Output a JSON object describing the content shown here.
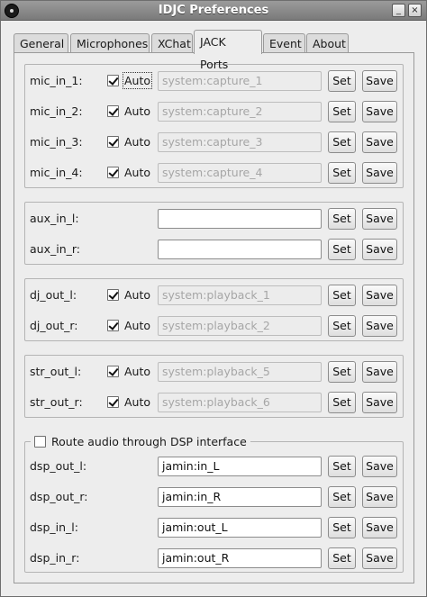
{
  "window": {
    "title": "IDJC Preferences",
    "minimize_label": "_",
    "close_label": "×"
  },
  "tabs": [
    {
      "label": "General"
    },
    {
      "label": "Microphones"
    },
    {
      "label": "XChat"
    },
    {
      "label": "JACK Ports",
      "active": true
    },
    {
      "label": "Event"
    },
    {
      "label": "About"
    }
  ],
  "buttons": {
    "set_label": "Set",
    "save_label": "Save"
  },
  "mic_ports": [
    {
      "label": "mic_in_1:",
      "auto_checked": true,
      "auto_label": "Auto",
      "value": "system:capture_1"
    },
    {
      "label": "mic_in_2:",
      "auto_checked": true,
      "auto_label": "Auto",
      "value": "system:capture_2"
    },
    {
      "label": "mic_in_3:",
      "auto_checked": true,
      "auto_label": "Auto",
      "value": "system:capture_3"
    },
    {
      "label": "mic_in_4:",
      "auto_checked": true,
      "auto_label": "Auto",
      "value": "system:capture_4"
    }
  ],
  "aux_ports": [
    {
      "label": "aux_in_l:",
      "value": ""
    },
    {
      "label": "aux_in_r:",
      "value": ""
    }
  ],
  "dj_ports": [
    {
      "label": "dj_out_l:",
      "auto_checked": true,
      "auto_label": "Auto",
      "value": "system:playback_1"
    },
    {
      "label": "dj_out_r:",
      "auto_checked": true,
      "auto_label": "Auto",
      "value": "system:playback_2"
    }
  ],
  "str_ports": [
    {
      "label": "str_out_l:",
      "auto_checked": true,
      "auto_label": "Auto",
      "value": "system:playback_5"
    },
    {
      "label": "str_out_r:",
      "auto_checked": true,
      "auto_label": "Auto",
      "value": "system:playback_6"
    }
  ],
  "dsp": {
    "route_label": "Route audio through DSP interface",
    "route_checked": false,
    "ports": [
      {
        "label": "dsp_out_l:",
        "value": "jamin:in_L"
      },
      {
        "label": "dsp_out_r:",
        "value": "jamin:in_R"
      },
      {
        "label": "dsp_in_l:",
        "value": "jamin:out_L"
      },
      {
        "label": "dsp_in_r:",
        "value": "jamin:out_R"
      }
    ]
  }
}
